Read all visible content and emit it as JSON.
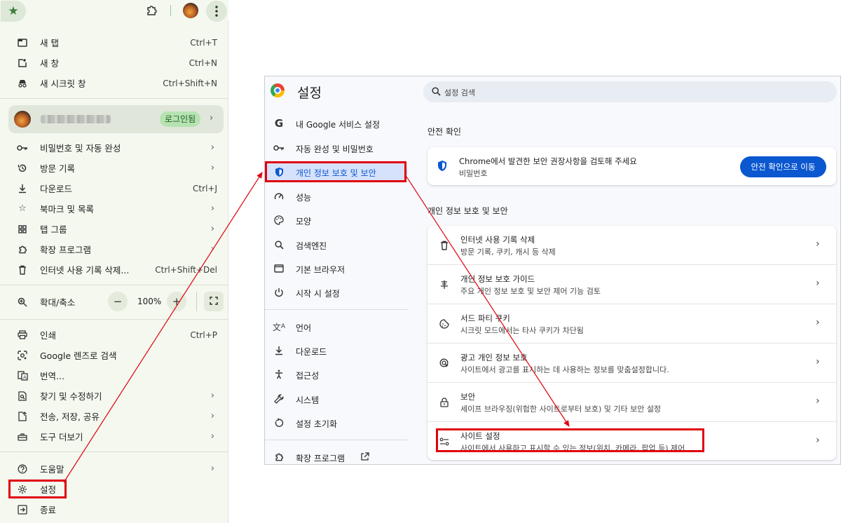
{
  "menu": {
    "new_tab": {
      "label": "새 탭",
      "shortcut": "Ctrl+T"
    },
    "new_window": {
      "label": "새 창",
      "shortcut": "Ctrl+N"
    },
    "incognito": {
      "label": "새 시크릿 창",
      "shortcut": "Ctrl+Shift+N"
    },
    "profile": {
      "status": "로그인됨"
    },
    "passwords": {
      "label": "비밀번호 및 자동 완성"
    },
    "history": {
      "label": "방문 기록"
    },
    "downloads": {
      "label": "다운로드",
      "shortcut": "Ctrl+J"
    },
    "bookmarks": {
      "label": "북마크 및 목록"
    },
    "tab_groups": {
      "label": "탭 그룹"
    },
    "extensions": {
      "label": "확장 프로그램"
    },
    "clear_data": {
      "label": "인터넷 사용 기록 삭제...",
      "shortcut": "Ctrl+Shift+Del"
    },
    "zoom": {
      "label": "확대/축소",
      "minus": "−",
      "value": "100%",
      "plus": "+"
    },
    "print": {
      "label": "인쇄",
      "shortcut": "Ctrl+P"
    },
    "lens": {
      "label": "Google 렌즈로 검색"
    },
    "translate": {
      "label": "번역..."
    },
    "find_edit": {
      "label": "찾기 및 수정하기"
    },
    "cast_save_share": {
      "label": "전송, 저장, 공유"
    },
    "more_tools": {
      "label": "도구 더보기"
    },
    "help": {
      "label": "도움말"
    },
    "settings": {
      "label": "설정"
    },
    "exit": {
      "label": "종료"
    }
  },
  "settings_window": {
    "title": "설정",
    "search_placeholder": "설정 검색",
    "nav": [
      {
        "label": "내 Google 서비스 설정",
        "icon": "google-g-icon"
      },
      {
        "label": "자동 완성 및 비밀번호",
        "icon": "key-icon"
      },
      {
        "label": "개인 정보 보호 및 보안",
        "icon": "shield-icon"
      },
      {
        "label": "성능",
        "icon": "speedometer-icon"
      },
      {
        "label": "모양",
        "icon": "palette-icon"
      },
      {
        "label": "검색엔진",
        "icon": "search-icon"
      },
      {
        "label": "기본 브라우저",
        "icon": "browser-icon"
      },
      {
        "label": "시작 시 설정",
        "icon": "power-icon"
      },
      {
        "label": "언어",
        "icon": "translate-icon"
      },
      {
        "label": "다운로드",
        "icon": "download-icon"
      },
      {
        "label": "접근성",
        "icon": "accessibility-icon"
      },
      {
        "label": "시스템",
        "icon": "wrench-icon"
      },
      {
        "label": "설정 초기화",
        "icon": "reset-icon"
      },
      {
        "label": "확장 프로그램",
        "icon": "puzzle-icon"
      }
    ],
    "safety_section_title": "안전 확인",
    "safety_card": {
      "title": "Chrome에서 발견한 보안 권장사항을 검토해 주세요",
      "subtitle": "비밀번호",
      "button": "안전 확인으로 이동"
    },
    "privacy_section_title": "개인 정보 보호 및 보안",
    "privacy_rows": [
      {
        "title": "인터넷 사용 기록 삭제",
        "subtitle": "방문 기록, 쿠키, 캐시 등 삭제",
        "icon": "trash-icon"
      },
      {
        "title": "개인 정보 보호 가이드",
        "subtitle": "주요 개인 정보 보호 및 보안 제어 기능 검토",
        "icon": "guide-icon"
      },
      {
        "title": "서드 파티 쿠키",
        "subtitle": "시크릿 모드에서는 타사 쿠키가 차단됨",
        "icon": "cookie-icon"
      },
      {
        "title": "광고 개인 정보 보호",
        "subtitle": "사이트에서 광고를 표시하는 데 사용하는 정보를 맞춤설정합니다.",
        "icon": "ads-icon"
      },
      {
        "title": "보안",
        "subtitle": "세이프 브라우징(위험한 사이트로부터 보호) 및 기타 보안 설정",
        "icon": "lock-icon"
      },
      {
        "title": "사이트 설정",
        "subtitle": "사이트에서 사용하고 표시할 수 있는 정보(위치, 카메라, 팝업 등) 제어",
        "icon": "sliders-icon"
      }
    ]
  },
  "colors": {
    "highlight": "#e0000e",
    "accent": "#0b57d0",
    "menu_bg": "#f4f8ef"
  }
}
